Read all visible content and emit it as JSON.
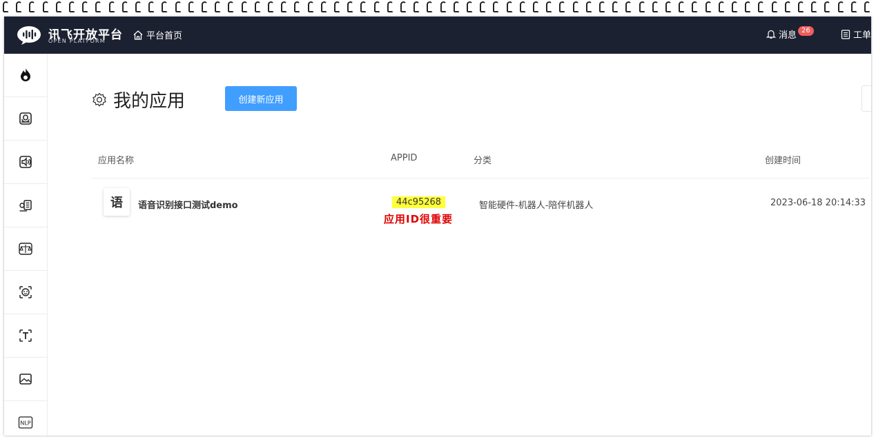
{
  "header": {
    "logo_cn": "讯飞开放平台",
    "logo_en": "OPEN PLATFORM",
    "home_link": "平台首页",
    "messages_label": "消息",
    "messages_count": "26",
    "ticket_label": "工单"
  },
  "sidebar": {
    "items": [
      {
        "icon": "flame-icon"
      },
      {
        "icon": "speech-recognition-icon"
      },
      {
        "icon": "speech-synthesis-icon"
      },
      {
        "icon": "voice-document-icon"
      },
      {
        "icon": "voice-evaluation-icon"
      },
      {
        "icon": "face-recognition-icon"
      },
      {
        "icon": "text-recognition-icon"
      },
      {
        "icon": "image-recognition-icon"
      },
      {
        "icon": "nlp-icon",
        "label": "NLP"
      }
    ]
  },
  "main": {
    "page_title": "我的应用",
    "create_button": "创建新应用",
    "columns": {
      "name": "应用名称",
      "appid": "APPID",
      "category": "分类",
      "created": "创建时间"
    },
    "rows": [
      {
        "icon_char": "语",
        "name": "语音识别接口测试demo",
        "appid": "44c95268",
        "category": "智能硬件-机器人-陪伴机器人",
        "created": "2023-06-18 20:14:33"
      }
    ],
    "annotation": "应用ID很重要"
  },
  "colors": {
    "topbar": "#1c2132",
    "primary_button": "#409eff",
    "badge": "#f05d5d",
    "highlight": "#ffff3a",
    "annotation": "#e00000"
  }
}
